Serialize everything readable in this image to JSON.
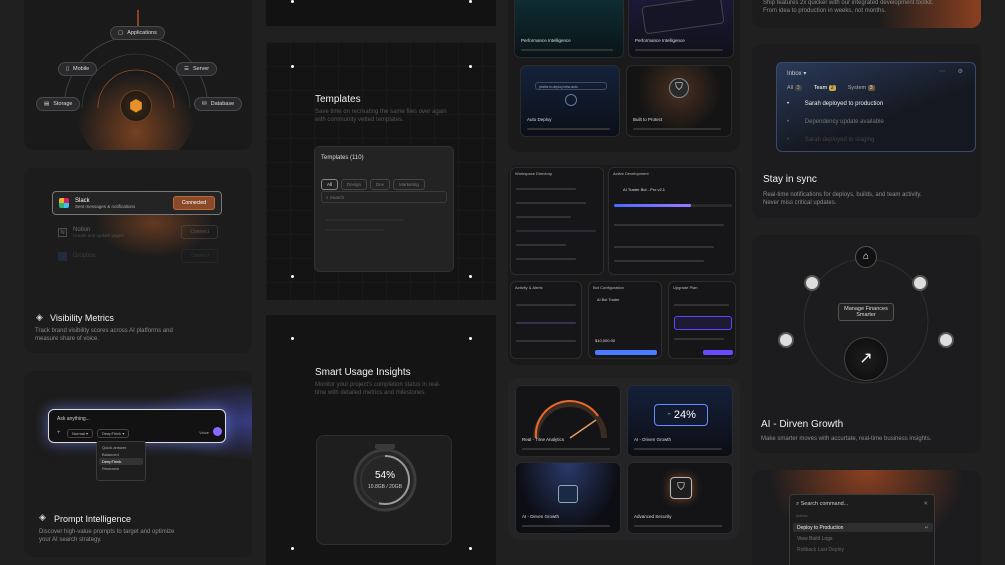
{
  "col1": {
    "diagram": {
      "nodes": [
        "Applications",
        "Mobile",
        "Server",
        "Storage",
        "Database"
      ],
      "icons": [
        "app-icon",
        "mobile-icon",
        "server-icon",
        "storage-icon",
        "database-icon"
      ]
    },
    "visibility": {
      "title": "Visibility Metrics",
      "desc": "Track brand visibility scores across AI platforms and measure share of voice.",
      "integrations": [
        {
          "name": "Slack",
          "desc": "Sent messages & notifications",
          "action": "Connected"
        },
        {
          "name": "Notion",
          "desc": "Create and update pages",
          "action": "Connect"
        },
        {
          "name": "Dropbox",
          "desc": "",
          "action": "Connect"
        }
      ]
    },
    "prompt": {
      "title": "Prompt Intelligence",
      "desc": "Discover high-value prompts to target and optimize your AI search strategy.",
      "placeholder": "Ask anything...",
      "mode": "Normal",
      "model": "DeepThink",
      "voice": "Voice",
      "options": [
        "Quick answer",
        "Balanced",
        "DeepThink",
        "Research"
      ]
    }
  },
  "col2": {
    "templates": {
      "title": "Templates",
      "desc": "Save time on recreating the same files over again with community vetted templates.",
      "panel_title": "Templates (110)",
      "filters": [
        "All",
        "Design",
        "Dev",
        "Marketing"
      ],
      "search": "Search"
    },
    "usage": {
      "title": "Smart Usage Insights",
      "desc": "Monitor your project's completion status in real-time with detailed metrics and milestones.",
      "percent": "54%",
      "storage": "10.8GB / 20GB",
      "fraction": 0.54
    }
  },
  "col3": {
    "top_tiles": [
      "Performance Intelligence",
      "Performance Intelligence",
      "Auto Deploy",
      "Built to Protect"
    ],
    "deploy_search": "platform.deploy/new.auto",
    "mini_titles": [
      "Workspace Directory",
      "Active Development",
      "Activity & Alerts",
      "Bot Configuration",
      "Upgrade Plan"
    ],
    "dev_task": "AI Trader Bot - Pro v2.1",
    "bot_name": "AI Bot Trader",
    "bot_value": "$10,000.00",
    "bottom_tiles": [
      "Real - Time Analytics",
      "AI - Driven Growth",
      "AI - Dirven Growth",
      "Advanced Security"
    ],
    "growth_percent": "24%"
  },
  "col4": {
    "top_desc": "Ship features 2x quicker with our integrated development toolkit. From idea to production in weeks, not months.",
    "inbox": {
      "title": "Inbox",
      "tabs": [
        {
          "label": "All",
          "count": "3"
        },
        {
          "label": "Team",
          "count": "2"
        },
        {
          "label": "System",
          "count": "3"
        }
      ],
      "items": [
        "Sarah deployed to production",
        "Dependency update available",
        "Sarah deployed to staging"
      ]
    },
    "sync": {
      "title": "Stay in sync",
      "desc": "Real-time notifications for deploys, builds, and team activity. Never miss critical updates."
    },
    "finance": {
      "center": "Manage Finances Smarter",
      "title": "AI - Dirven Growth",
      "desc": "Make smarter moves with accurtate, real-time business insights."
    },
    "command": {
      "placeholder": "Search command...",
      "section": "Actions",
      "items": [
        "Deploy to Production",
        "View Build Logs",
        "Rollback Last Deploy"
      ]
    }
  },
  "colors": {
    "accent": "#e8702a",
    "bg": "#202020",
    "card": "#1c1c1e",
    "blue": "#5b8cff",
    "purple": "#7a4cff"
  }
}
